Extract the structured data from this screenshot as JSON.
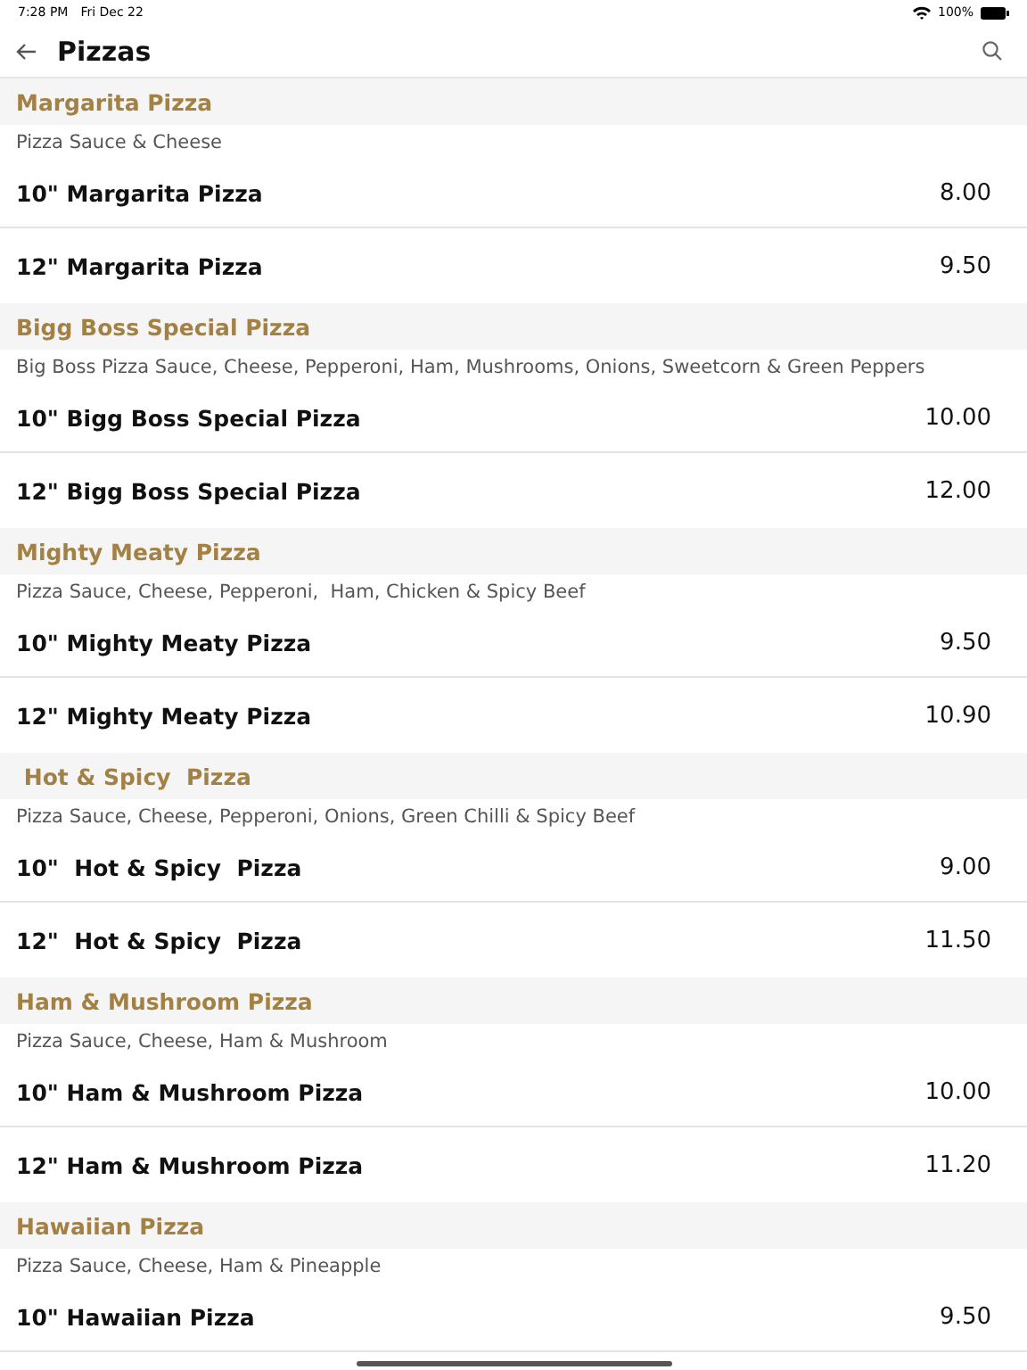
{
  "status_bar": {
    "time": "7:28 PM",
    "date": "Fri Dec 22",
    "battery": "100%"
  },
  "header": {
    "title": "Pizzas"
  },
  "sections": [
    {
      "title": "Margarita Pizza",
      "description": "Pizza Sauce & Cheese",
      "items": [
        {
          "name": "10\" Margarita Pizza",
          "price": "8.00"
        },
        {
          "name": "12\" Margarita Pizza",
          "price": "9.50"
        }
      ]
    },
    {
      "title": "Bigg Boss Special Pizza",
      "description": "Big Boss Pizza Sauce, Cheese, Pepperoni, Ham, Mushrooms, Onions, Sweetcorn & Green Peppers",
      "items": [
        {
          "name": "10\" Bigg Boss Special Pizza",
          "price": "10.00"
        },
        {
          "name": "12\" Bigg Boss Special Pizza",
          "price": "12.00"
        }
      ]
    },
    {
      "title": "Mighty Meaty Pizza",
      "description": "Pizza Sauce, Cheese, Pepperoni,  Ham, Chicken & Spicy Beef",
      "items": [
        {
          "name": "10\" Mighty Meaty Pizza",
          "price": "9.50"
        },
        {
          "name": "12\" Mighty Meaty Pizza",
          "price": "10.90"
        }
      ]
    },
    {
      "title": " Hot & Spicy  Pizza",
      "description": "Pizza Sauce, Cheese, Pepperoni, Onions, Green Chilli & Spicy Beef",
      "items": [
        {
          "name": "10\"  Hot & Spicy  Pizza",
          "price": "9.00"
        },
        {
          "name": "12\"  Hot & Spicy  Pizza",
          "price": "11.50"
        }
      ]
    },
    {
      "title": "Ham & Mushroom Pizza",
      "description": "Pizza Sauce, Cheese, Ham & Mushroom",
      "items": [
        {
          "name": "10\" Ham & Mushroom Pizza",
          "price": "10.00"
        },
        {
          "name": "12\" Ham & Mushroom Pizza",
          "price": "11.20"
        }
      ]
    },
    {
      "title": "Hawaiian Pizza",
      "description": "Pizza Sauce, Cheese, Ham & Pineapple",
      "items": [
        {
          "name": "10\" Hawaiian Pizza",
          "price": "9.50"
        }
      ]
    }
  ]
}
